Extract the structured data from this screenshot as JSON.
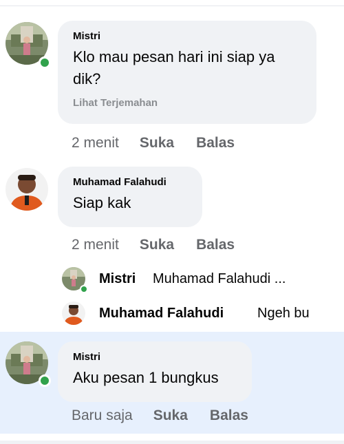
{
  "comments": [
    {
      "author": "Mistri",
      "text": "Klo mau pesan hari ini siap ya dik?",
      "translate": "Lihat Terjemahan",
      "time": "2 menit",
      "like": "Suka",
      "reply": "Balas"
    },
    {
      "author": "Muhamad Falahudi",
      "text": "Siap kak",
      "time": "2 menit",
      "like": "Suka",
      "reply": "Balas"
    },
    {
      "author": "Mistri",
      "text": "Aku pesan 1 bungkus",
      "time": "Baru saja",
      "like": "Suka",
      "reply": "Balas"
    }
  ],
  "replies": [
    {
      "author": "Mistri",
      "text": "Muhamad Falahudi ..."
    },
    {
      "author": "Muhamad Falahudi",
      "text": "Ngeh bu"
    }
  ],
  "colors": {
    "bubble": "#f0f2f5",
    "highlight": "#e7f0fd",
    "online": "#31a24c",
    "meta": "#65676b"
  },
  "icons": {
    "online_status": "online-dot-icon"
  }
}
